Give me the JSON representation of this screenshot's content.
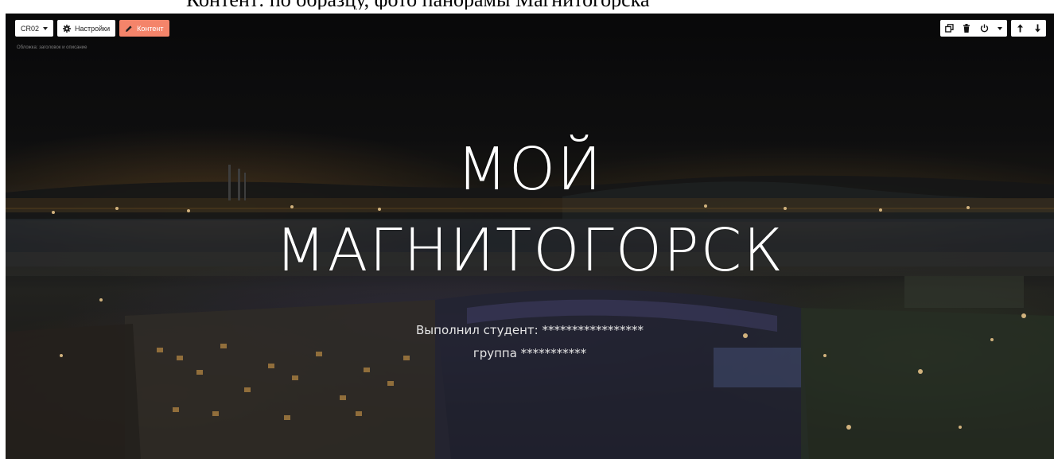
{
  "caption": "Контент: по образцу, фото панорамы Магнитогорска",
  "toolbar_left": {
    "block_code": "CR02",
    "settings_label": "Настройки",
    "content_label": "Контент",
    "block_description": "Обложка: заголовок и описание"
  },
  "toolbar_right": {
    "icons": [
      "duplicate-icon",
      "trash-icon",
      "power-icon",
      "chevron-down-icon",
      "arrow-up-icon",
      "arrow-down-icon"
    ]
  },
  "cover": {
    "title_line1": "МОЙ",
    "title_line2": "МАГНИТОГОРСК",
    "subtitle_line1": "Выполнил студент: *****************",
    "subtitle_line2": "группа ***********"
  },
  "colors": {
    "accent": "#f4846a",
    "toolbar_bg": "#ffffff",
    "title": "#ffffff"
  }
}
